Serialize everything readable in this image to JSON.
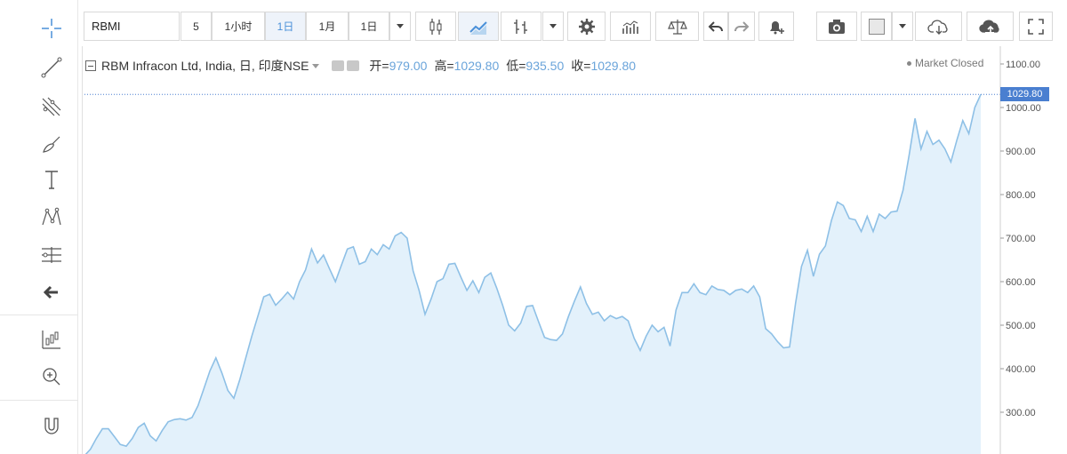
{
  "symbol": "RBMI",
  "toolbar": {
    "interval_5": "5",
    "interval_1h": "1小时",
    "interval_1d_active": "1日",
    "interval_1m": "1月",
    "interval_1d": "1日"
  },
  "legend": {
    "title": "RBM Infracon Ltd, India, 日, 印度NSE",
    "open_label": "开=",
    "open_value": "979.00",
    "high_label": "高=",
    "high_value": "1029.80",
    "low_label": "低=",
    "low_value": "935.50",
    "close_label": "收=",
    "close_value": "1029.80"
  },
  "market_status": "Market Closed",
  "last_price": "1029.80",
  "colors": {
    "line": "#8ec0e6",
    "fill": "#e3f1fb",
    "accent": "#4a7fd0"
  },
  "chart_data": {
    "type": "area",
    "y_ticks": [
      "1100.00",
      "1000.00",
      "900.00",
      "800.00",
      "700.00",
      "600.00",
      "500.00",
      "400.00",
      "300.00"
    ],
    "ylim": [
      260,
      1120
    ],
    "values": [
      200,
      215,
      240,
      262,
      262,
      244,
      226,
      222,
      240,
      265,
      275,
      246,
      234,
      258,
      278,
      283,
      285,
      282,
      288,
      315,
      355,
      395,
      425,
      390,
      350,
      332,
      375,
      425,
      475,
      520,
      565,
      571,
      546,
      560,
      576,
      560,
      600,
      627,
      675,
      643,
      661,
      630,
      600,
      638,
      675,
      680,
      640,
      646,
      675,
      662,
      685,
      675,
      705,
      713,
      700,
      625,
      580,
      525,
      560,
      600,
      607,
      640,
      642,
      610,
      580,
      602,
      575,
      610,
      620,
      585,
      545,
      500,
      487,
      505,
      543,
      545,
      508,
      472,
      467,
      465,
      480,
      520,
      555,
      588,
      550,
      525,
      530,
      510,
      522,
      515,
      520,
      510,
      470,
      442,
      475,
      500,
      485,
      495,
      452,
      535,
      575,
      575,
      595,
      575,
      570,
      590,
      582,
      580,
      570,
      580,
      583,
      575,
      590,
      565,
      492,
      480,
      462,
      448,
      450,
      550,
      635,
      672,
      612,
      663,
      682,
      740,
      783,
      775,
      745,
      742,
      715,
      750,
      715,
      755,
      745,
      760,
      762,
      810,
      890,
      975,
      905,
      945,
      915,
      925,
      905,
      875,
      925,
      970,
      940,
      1000,
      1030
    ]
  }
}
